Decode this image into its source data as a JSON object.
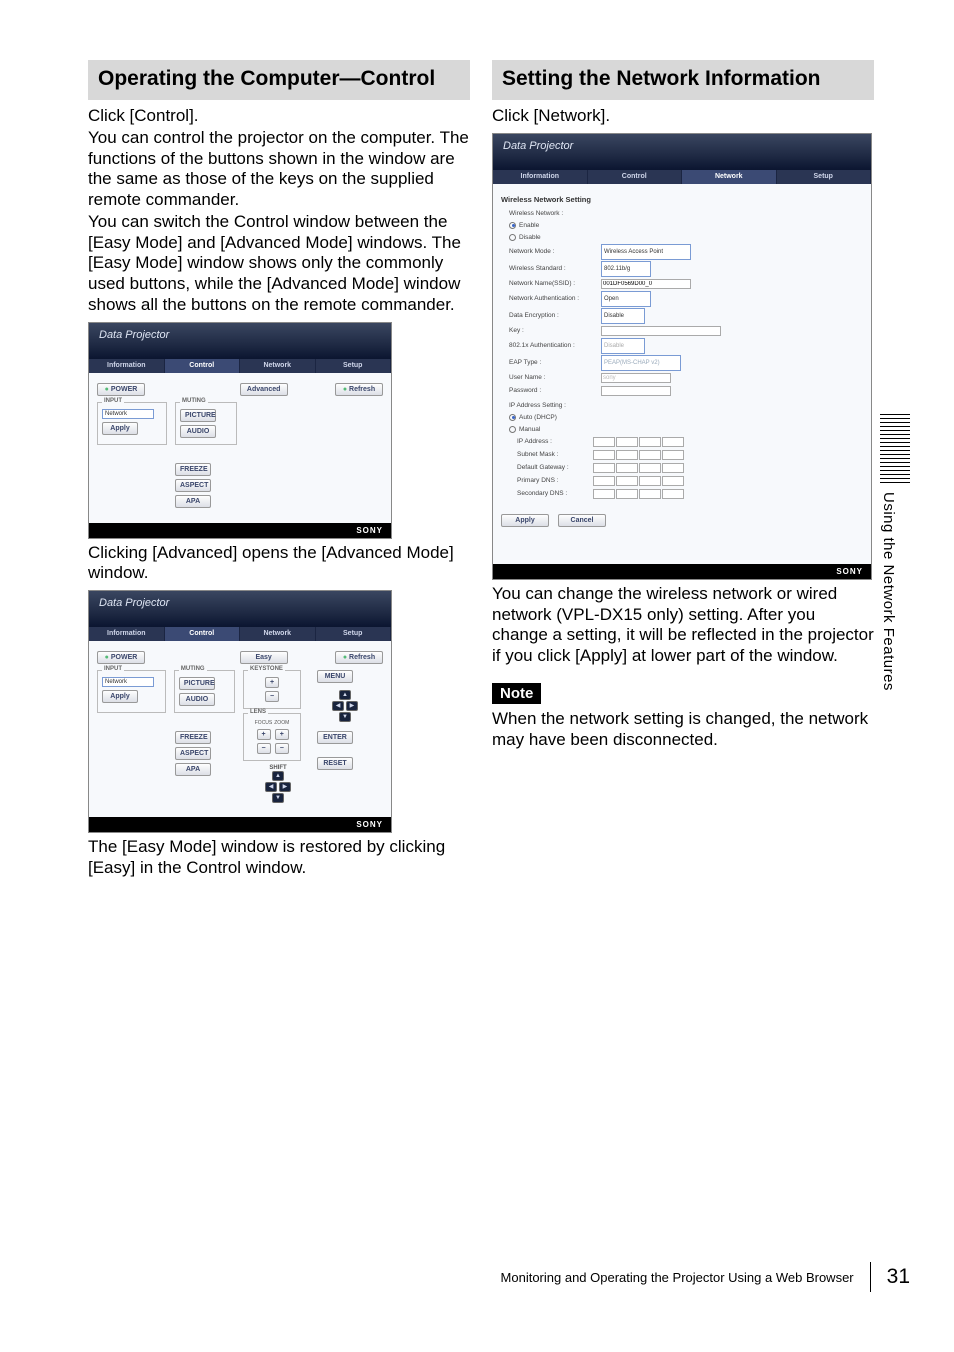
{
  "left": {
    "heading": "Operating the Computer—Control",
    "p1": "Click [Control].",
    "p2": "You can control the projector on the computer. The functions of the buttons shown in the window are the same as those of the keys on the supplied remote commander.",
    "p3": "You can switch the Control window between the [Easy Mode] and [Advanced Mode] windows. The [Easy Mode] window shows only the commonly used buttons, while the [Advanced Mode] window shows all the buttons on the remote commander.",
    "fig1": {
      "title": "Data Projector",
      "tabs": {
        "info": "Information",
        "control": "Control",
        "network": "Network",
        "setup": "Setup"
      },
      "power": "POWER",
      "advanced": "Advanced",
      "refresh": "Refresh",
      "input_legend": "INPUT",
      "muting_legend": "MUTING",
      "input_select": "Network",
      "apply": "Apply",
      "picture": "PICTURE",
      "audio": "AUDIO",
      "freeze": "FREEZE",
      "aspect": "ASPECT",
      "apa": "APA",
      "footer": "SONY"
    },
    "p4": "Clicking [Advanced] opens the [Advanced Mode] window.",
    "fig2": {
      "title": "Data Projector",
      "tabs": {
        "info": "Information",
        "control": "Control",
        "network": "Network",
        "setup": "Setup"
      },
      "power": "POWER",
      "easy": "Easy",
      "refresh": "Refresh",
      "input_legend": "INPUT",
      "muting_legend": "MUTING",
      "keystone_legend": "KEYSTONE",
      "lens_legend": "LENS",
      "focus": "FOCUS",
      "zoom": "ZOOM",
      "shift": "SHIFT",
      "input_select": "Network",
      "apply": "Apply",
      "picture": "PICTURE",
      "audio": "AUDIO",
      "freeze": "FREEZE",
      "aspect": "ASPECT",
      "apa": "APA",
      "menu": "MENU",
      "enter": "ENTER",
      "reset": "RESET",
      "footer": "SONY"
    },
    "p5": "The [Easy Mode] window is restored by clicking [Easy] in the Control window."
  },
  "right": {
    "heading": "Setting the Network Information",
    "p1": "Click [Network].",
    "fig": {
      "title": "Data Projector",
      "tabs": {
        "info": "Information",
        "control": "Control",
        "network": "Network",
        "setup": "Setup"
      },
      "section": "Wireless Network Setting",
      "wn_label": "Wireless Network :",
      "enable": "Enable",
      "disable": "Disable",
      "rows": {
        "mode": {
          "l": "Network Mode :",
          "v": "Wireless Access Point"
        },
        "standard": {
          "l": "Wireless Standard :",
          "v": "802.11b/g"
        },
        "ssid": {
          "l": "Network Name(SSID) :",
          "v": "001DF0569D00_0"
        },
        "auth": {
          "l": "Network Authentication :",
          "v": "Open"
        },
        "enc": {
          "l": "Data Encryption :",
          "v": "Disable"
        },
        "key": {
          "l": "Key :",
          "v": ""
        },
        "x8021": {
          "l": "802.1x Authentication :",
          "v": "Disable"
        },
        "eap": {
          "l": "EAP Type :",
          "v": "PEAP(MS-CHAP v2)"
        },
        "user": {
          "l": "User Name :",
          "v": "sony"
        },
        "pass": {
          "l": "Password :",
          "v": ""
        }
      },
      "ipsetting": "IP Address Setting :",
      "auto": "Auto (DHCP)",
      "manual": "Manual",
      "ip": "IP Address :",
      "subnet": "Subnet Mask :",
      "gateway": "Default Gateway :",
      "pdns": "Primary DNS :",
      "sdns": "Secondary DNS :",
      "apply": "Apply",
      "cancel": "Cancel",
      "footer": "SONY"
    },
    "p2": "You can change the wireless network or wired network (VPL-DX15 only) setting. After you change a setting, it will be reflected in the projector if you click [Apply] at lower part of the window.",
    "note_label": "Note",
    "note_text": "When the network setting is changed, the network may have been disconnected."
  },
  "side_label": "Using the Network Features",
  "footer": {
    "text": "Monitoring and Operating the Projector Using a Web Browser",
    "page": "31"
  }
}
